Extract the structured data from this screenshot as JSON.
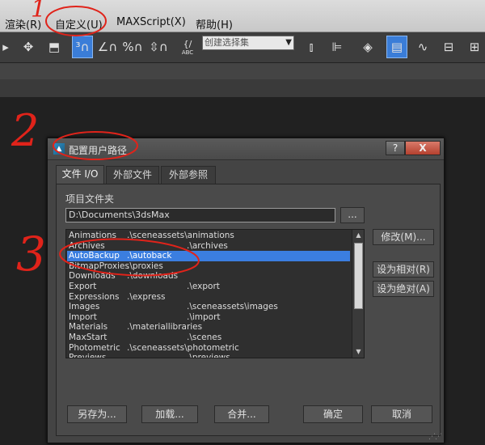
{
  "menu": {
    "items": [
      {
        "label": "渲染(R)"
      },
      {
        "label": "自定义(U)"
      },
      {
        "label": "MAXScript(X)"
      },
      {
        "label": "帮助(H)"
      }
    ]
  },
  "toolbar": {
    "selection_set_placeholder": "创建选择集",
    "abc_label": "ABC",
    "icons": [
      "move-icon",
      "select-region-icon",
      "snap-3d-icon",
      "angle-snap-icon",
      "percent-snap-icon",
      "spinner-snap-icon",
      "edit-named-selection-icon",
      "mirror-icon",
      "align-icon",
      "layer-manager-icon",
      "toggle-ribbon-icon",
      "curve-editor-icon",
      "schematic-view-icon",
      "material-editor-icon"
    ]
  },
  "dialog": {
    "title": "配置用户路径",
    "help_button": "?",
    "close_button": "X",
    "tabs": [
      {
        "label": "文件 I/O",
        "active": true
      },
      {
        "label": "外部文件",
        "active": false
      },
      {
        "label": "外部参照",
        "active": false
      }
    ],
    "project_folder_label": "项目文件夹",
    "project_folder_value": "D:\\Documents\\3dsMax",
    "browse_label": "...",
    "paths": [
      {
        "name": "Animations",
        "path": ".\\sceneassets\\animations",
        "offset": 74
      },
      {
        "name": "Archives",
        "path": ".\\archives",
        "offset": 148
      },
      {
        "name": "AutoBackup",
        "path": ".\\autoback",
        "offset": 74,
        "selected": true
      },
      {
        "name": "BitmapProxies",
        "path": ".\\proxies",
        "offset": 74
      },
      {
        "name": "Downloads",
        "path": ".\\downloads",
        "offset": 74
      },
      {
        "name": "Export",
        "path": ".\\export",
        "offset": 148
      },
      {
        "name": "Expressions",
        "path": ".\\express",
        "offset": 74
      },
      {
        "name": "Images",
        "path": ".\\sceneassets\\images",
        "offset": 148
      },
      {
        "name": "Import",
        "path": ".\\import",
        "offset": 148
      },
      {
        "name": "Materials",
        "path": ".\\materiallibraries",
        "offset": 74
      },
      {
        "name": "MaxStart",
        "path": ".\\scenes",
        "offset": 148
      },
      {
        "name": "Photometric",
        "path": ".\\sceneassets\\photometric",
        "offset": 74
      },
      {
        "name": "Previews",
        "path": ".\\previews",
        "offset": 148
      }
    ],
    "modify_button": "修改(M)...",
    "make_relative_button": "设为相对(R)",
    "make_absolute_button": "设为绝对(A)",
    "save_as_button": "另存为...",
    "load_button": "加载...",
    "merge_button": "合并...",
    "ok_button": "确定",
    "cancel_button": "取消"
  },
  "annotations": {
    "mark_1": "1",
    "mark_2": "2",
    "mark_3": "3",
    "color": "#e0231a"
  },
  "colors": {
    "selection": "#3b7ee0",
    "dialog_bg": "#444444",
    "close_button": "#c4503e"
  }
}
